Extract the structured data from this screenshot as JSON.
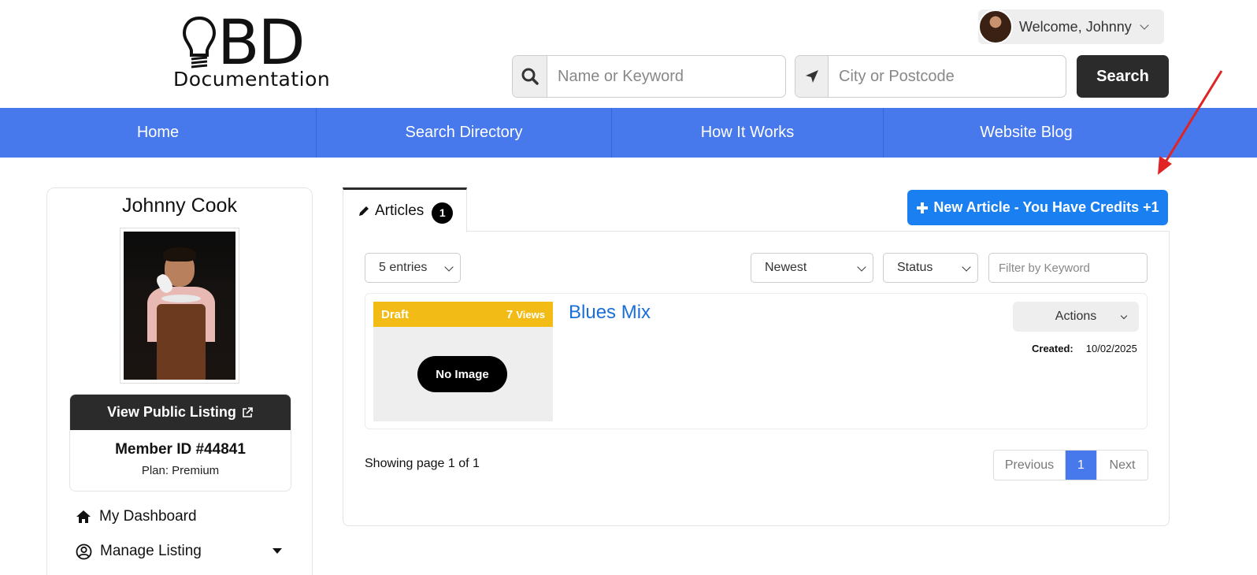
{
  "logo": {
    "letters": "BD",
    "subtitle": "Documentation"
  },
  "user": {
    "welcome": "Welcome, Johnny"
  },
  "search": {
    "keyword_placeholder": "Name or Keyword",
    "location_placeholder": "City or Postcode",
    "button": "Search"
  },
  "nav": {
    "items": [
      {
        "label": "Home"
      },
      {
        "label": "Search Directory"
      },
      {
        "label": "How It Works"
      },
      {
        "label": "Website Blog"
      }
    ]
  },
  "sidebar": {
    "name": "Johnny Cook",
    "view_listing": "View Public Listing",
    "member_id": "Member ID #44841",
    "plan": "Plan: Premium",
    "links": [
      {
        "label": "My Dashboard",
        "icon": "home-icon"
      },
      {
        "label": "Manage Listing",
        "icon": "user-circle-icon"
      }
    ]
  },
  "articles": {
    "tab_label": "Articles",
    "tab_count": "1",
    "new_button": "New Article - You Have Credits +1",
    "entries_select": "5 entries",
    "sort_select": "Newest",
    "status_select": "Status",
    "filter_placeholder": "Filter by Keyword",
    "items": [
      {
        "status": "Draft",
        "views_count": "7",
        "views_label": "Views",
        "no_image": "No Image",
        "title": "Blues Mix",
        "actions": "Actions",
        "created_label": "Created:",
        "created_date": "10/02/2025"
      }
    ],
    "showing": "Showing page 1 of 1",
    "pager": {
      "previous": "Previous",
      "current": "1",
      "next": "Next"
    }
  },
  "colors": {
    "nav": "#4778ec",
    "primary_button": "#1a7ff0",
    "draft_badge": "#f3bb16",
    "dark_button": "#2b2b2b",
    "link": "#1a6ed8",
    "annotation_arrow": "#e02424"
  }
}
